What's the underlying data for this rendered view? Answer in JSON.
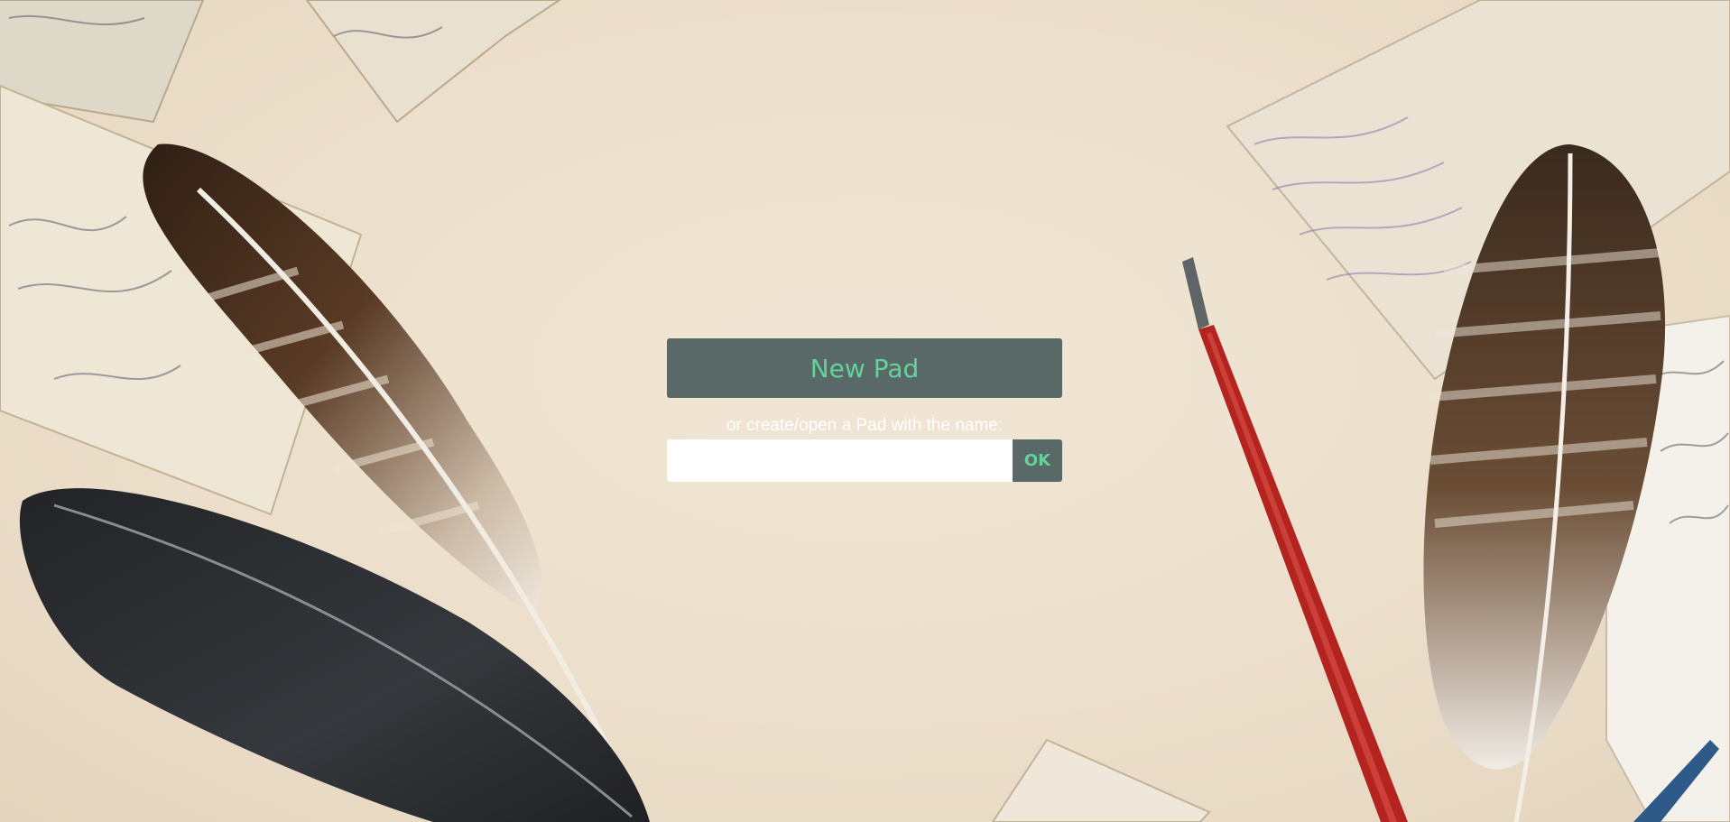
{
  "main": {
    "new_pad_label": "New Pad",
    "create_open_label": "or create/open a Pad with the name:",
    "pad_name_value": "",
    "pad_name_placeholder": "",
    "ok_label": "OK"
  },
  "colors": {
    "button_bg": "#596968",
    "button_text": "#64d29b",
    "label_text": "#ffffff",
    "background": "#ecdfcb"
  },
  "background_icons": [
    "postcard-image",
    "feather-image",
    "dip-pen-image"
  ]
}
